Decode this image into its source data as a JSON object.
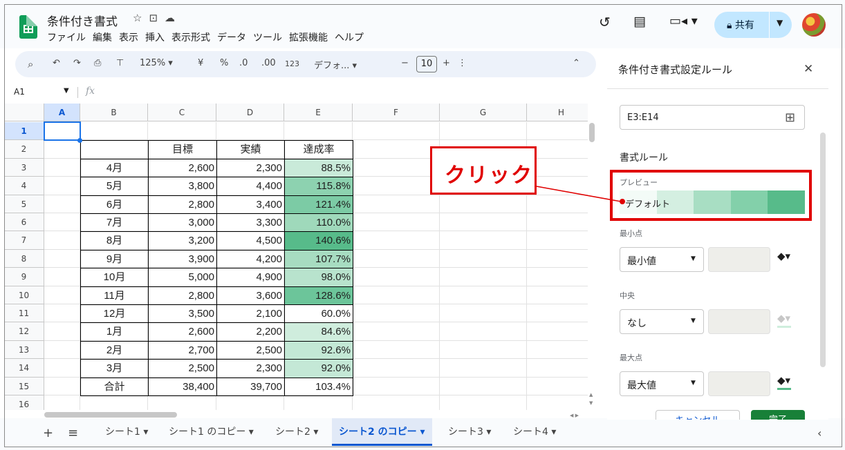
{
  "app": {
    "doc_title": "条件付き書式",
    "menu": [
      "ファイル",
      "編集",
      "表示",
      "挿入",
      "表示形式",
      "データ",
      "ツール",
      "拡張機能",
      "ヘルプ"
    ],
    "share_label": "共有"
  },
  "toolbar": {
    "zoom": "125%",
    "currency": "¥",
    "percent": "%",
    "dec_decrease": ".0",
    "dec_increase": ".00",
    "number_format": "123",
    "font": "デフォ...",
    "minus": "−",
    "font_size": "10",
    "plus": "+"
  },
  "formula_bar": {
    "cell_ref": "A1",
    "fx": "fx"
  },
  "grid": {
    "columns": [
      "A",
      "B",
      "C",
      "D",
      "E",
      "F",
      "G",
      "H"
    ],
    "row_numbers": [
      "1",
      "2",
      "3",
      "4",
      "5",
      "6",
      "7",
      "8",
      "9",
      "10",
      "11",
      "12",
      "13",
      "14",
      "15",
      "16"
    ],
    "table_header": [
      "",
      "目標",
      "実績",
      "達成率"
    ],
    "rows": [
      {
        "month": "4月",
        "target": "2,600",
        "actual": "2,300",
        "rate": "88.5%",
        "fill": "#c9ead9"
      },
      {
        "month": "5月",
        "target": "3,800",
        "actual": "4,400",
        "rate": "115.8%",
        "fill": "#8dd2b0"
      },
      {
        "month": "6月",
        "target": "2,800",
        "actual": "3,400",
        "rate": "121.4%",
        "fill": "#7ccba5"
      },
      {
        "month": "7月",
        "target": "3,000",
        "actual": "3,300",
        "rate": "110.0%",
        "fill": "#9fd9bb"
      },
      {
        "month": "8月",
        "target": "3,200",
        "actual": "4,500",
        "rate": "140.6%",
        "fill": "#57bb8a"
      },
      {
        "month": "9月",
        "target": "3,900",
        "actual": "4,200",
        "rate": "107.7%",
        "fill": "#a7dcc1"
      },
      {
        "month": "10月",
        "target": "5,000",
        "actual": "4,900",
        "rate": "98.0%",
        "fill": "#b8e3cd"
      },
      {
        "month": "11月",
        "target": "2,800",
        "actual": "3,600",
        "rate": "128.6%",
        "fill": "#6cc59a"
      },
      {
        "month": "12月",
        "target": "3,500",
        "actual": "2,100",
        "rate": "60.0%",
        "fill": "#ffffff"
      },
      {
        "month": "1月",
        "target": "2,600",
        "actual": "2,200",
        "rate": "84.6%",
        "fill": "#cfeddd"
      },
      {
        "month": "2月",
        "target": "2,700",
        "actual": "2,500",
        "rate": "92.6%",
        "fill": "#c3e8d5"
      },
      {
        "month": "3月",
        "target": "2,500",
        "actual": "2,300",
        "rate": "92.0%",
        "fill": "#c4e8d6"
      }
    ],
    "total": {
      "month": "合計",
      "target": "38,400",
      "actual": "39,700",
      "rate": "103.4%"
    }
  },
  "sheet_tabs": [
    {
      "label": "シート1",
      "active": false
    },
    {
      "label": "シート1 のコピー",
      "active": false
    },
    {
      "label": "シート2",
      "active": false
    },
    {
      "label": "シート2 のコピー",
      "active": true
    },
    {
      "label": "シート3",
      "active": false
    },
    {
      "label": "シート4",
      "active": false
    }
  ],
  "panel": {
    "title": "条件付き書式設定ルール",
    "range": "E3:E14",
    "format_rules": "書式ルール",
    "preview_label": "プレビュー",
    "preview_text": "デフォルト",
    "preview_colors": [
      "#f3fbf7",
      "#d4efe1",
      "#a8dec3",
      "#83d0aa",
      "#57bb8a"
    ],
    "min_label": "最小点",
    "min_value": "最小値",
    "mid_label": "中央",
    "mid_value": "なし",
    "max_label": "最大点",
    "max_value": "最大値",
    "cancel": "キャンセル",
    "done": "完了",
    "colors": {
      "min": "#ffffff",
      "mid": "#cfeedd",
      "max": "#57bb8a"
    }
  },
  "annotation": {
    "callout_text": "クリック",
    "color": "#e00000"
  }
}
